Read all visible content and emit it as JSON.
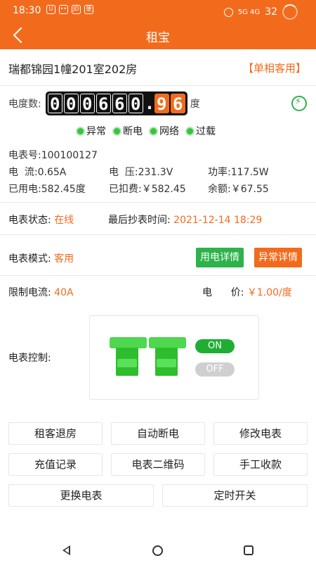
{
  "statusbar": {
    "time": "18:30",
    "notif_icons": [
      "U",
      "••",
      "JD",
      "便"
    ],
    "signal": "5G 4G",
    "battery": "32"
  },
  "header": {
    "title": "租宝"
  },
  "room": {
    "name": "瑞都锦园1幢201室202房",
    "type": "【单相客用】"
  },
  "meter": {
    "reading_label": "电度数:",
    "integer_digits": [
      "0",
      "0",
      "0",
      "6",
      "6",
      "0"
    ],
    "decimal_point": ".",
    "decimal_digits": [
      "9",
      "6"
    ],
    "unit": "度"
  },
  "indicators": [
    "异常",
    "断电",
    "网络",
    "过载"
  ],
  "details": {
    "meter_no_label": "电表号:",
    "meter_no": "100100127",
    "current_label": "电  流:",
    "current": "0.65A",
    "voltage_label": "电  压:",
    "voltage": "231.3V",
    "power_label": "功率:",
    "power": "117.5W",
    "used_label": "已用电:",
    "used": "582.45度",
    "deducted_label": "已扣费:",
    "deducted": "￥582.45",
    "balance_label": "余额:",
    "balance": "￥67.55"
  },
  "status": {
    "state_label": "电表状态:",
    "state": "在线",
    "last_read_label": "最后抄表时间:",
    "last_read": "2021-12-14 18:29"
  },
  "mode": {
    "label": "电表模式:",
    "value": "客用",
    "usage_btn": "用电详情",
    "abnormal_btn": "异常详情"
  },
  "limits": {
    "current_label": "限制电流:",
    "current_value": "40A",
    "price_label": "电      价:",
    "price_value": "￥1.00/度"
  },
  "control": {
    "label": "电表控制:",
    "on_label": "ON",
    "off_label": "OFF"
  },
  "actions": [
    "租客退房",
    "自动断电",
    "修改电表",
    "充值记录",
    "电表二维码",
    "手工收款",
    "更换电表",
    "定时开关"
  ],
  "colors": {
    "accent": "#f26b1d",
    "green": "#2db34a"
  }
}
